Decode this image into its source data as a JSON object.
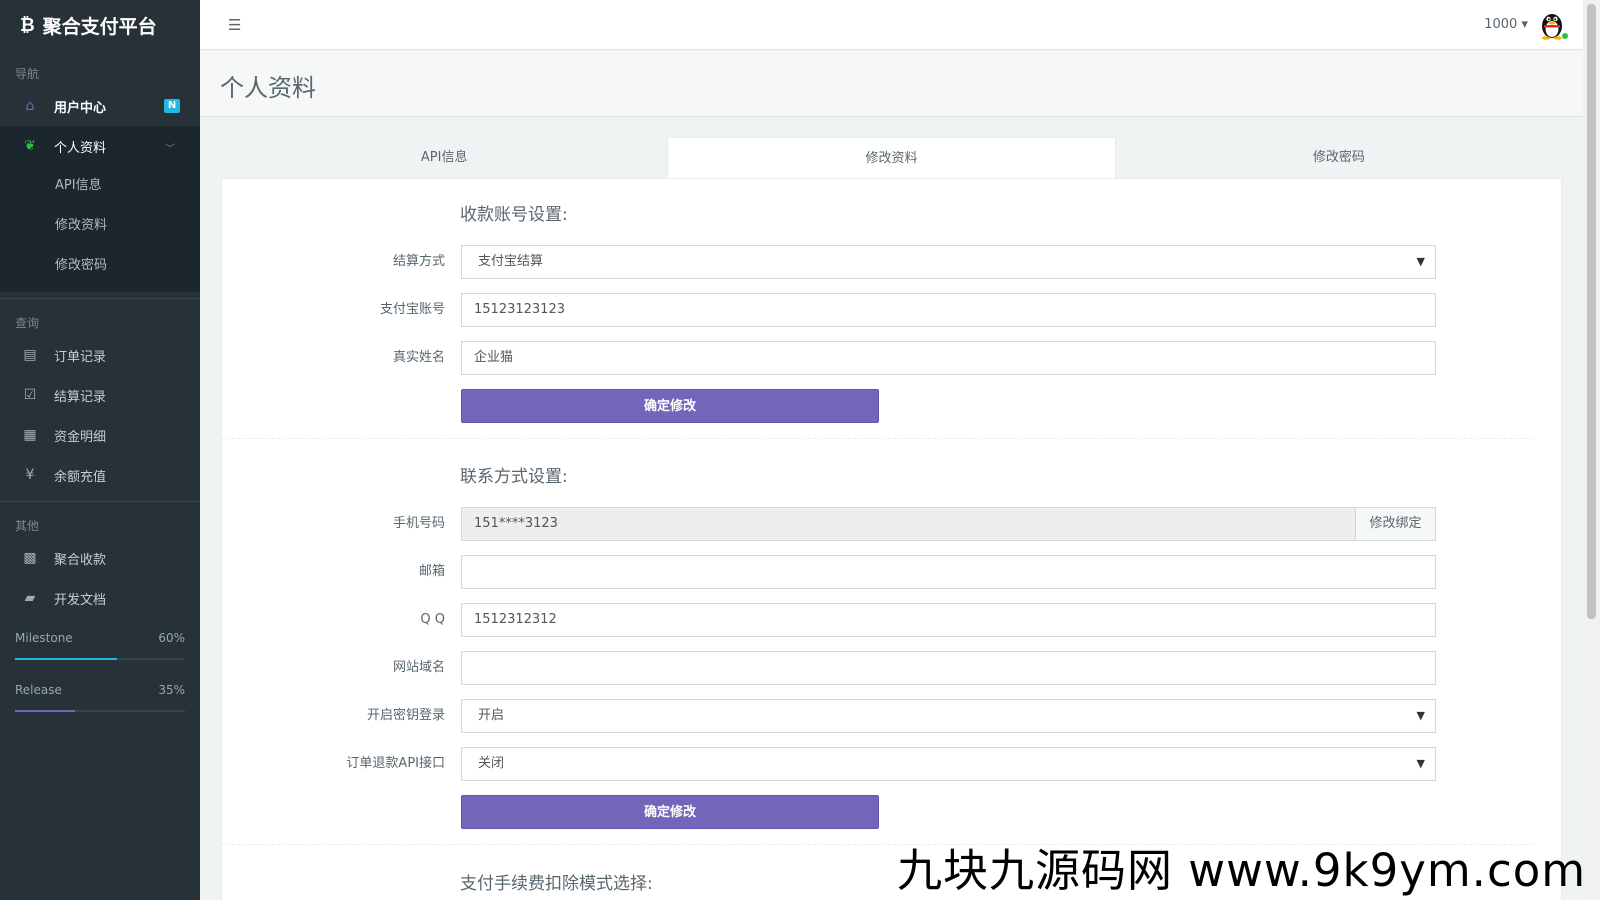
{
  "brand": {
    "logo": "₿",
    "name": "聚合支付平台"
  },
  "sidebar": {
    "section_nav": "导航",
    "user_center": "用户中心",
    "user_center_badge": "N",
    "profile": "个人资料",
    "profile_sub": [
      "API信息",
      "修改资料",
      "修改密码"
    ],
    "section_query": "查询",
    "query_items": [
      "订单记录",
      "结算记录",
      "资金明细",
      "余额充值"
    ],
    "section_other": "其他",
    "other_items": [
      "聚合收款",
      "开发文档"
    ],
    "progress": [
      {
        "label": "Milestone",
        "value": "60%",
        "fraction": 0.6,
        "color": "#23b7e5"
      },
      {
        "label": "Release",
        "value": "35%",
        "fraction": 0.35,
        "color": "#7266ba"
      }
    ]
  },
  "header": {
    "user": "1000"
  },
  "page": {
    "title": "个人资料"
  },
  "tabs": [
    "API信息",
    "修改资料",
    "修改密码"
  ],
  "account": {
    "title": "收款账号设置:",
    "settle_label": "结算方式",
    "settle_value": "支付宝结算",
    "alipay_label": "支付宝账号",
    "alipay_value": "15123123123",
    "realname_label": "真实姓名",
    "realname_value": "企业猫",
    "submit": "确定修改"
  },
  "contact": {
    "title": "联系方式设置:",
    "phone_label": "手机号码",
    "phone_value": "151****3123",
    "phone_action": "修改绑定",
    "email_label": "邮箱",
    "email_value": "",
    "qq_label": "Q Q",
    "qq_value": "1512312312",
    "site_label": "网站域名",
    "site_value": "",
    "keylogin_label": "开启密钥登录",
    "keylogin_value": "开启",
    "refund_label": "订单退款API接口",
    "refund_value": "关闭",
    "submit": "确定修改"
  },
  "fee": {
    "title": "支付手续费扣除模式选择:"
  },
  "watermark": "九块九源码网 www.9k9ym.com"
}
